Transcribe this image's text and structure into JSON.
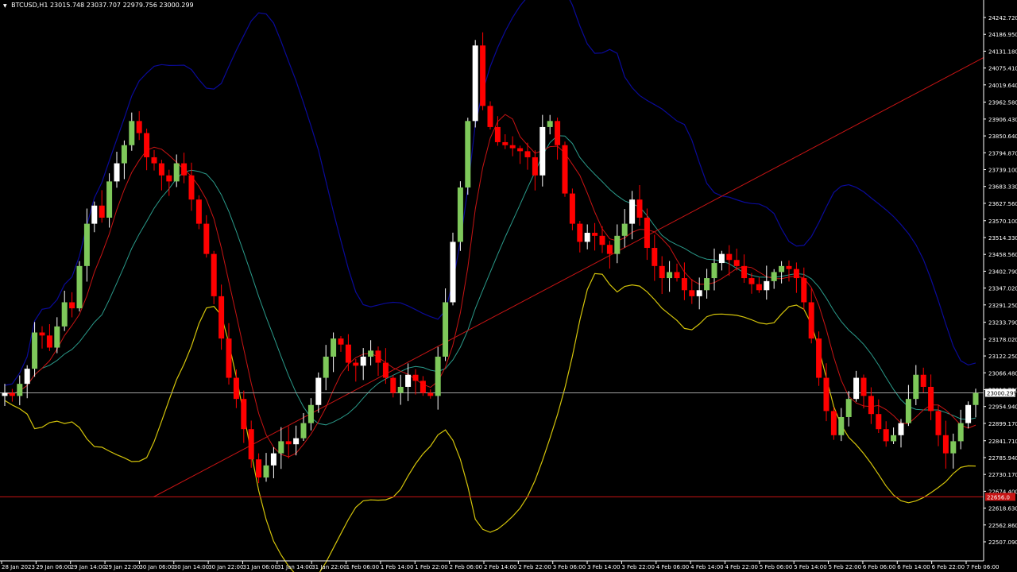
{
  "header": {
    "symbol": "BTCUSD,H1",
    "ohlc": "23015.748 23037.707 22979.756 23000.299"
  },
  "colors": {
    "background": "#000000",
    "axis": "#ffffff",
    "bull_candle": "#7ec85a",
    "bull_wick": "#ffffff",
    "bear_candle": "#ff0000",
    "bb_upper": "#0a0a9a",
    "bb_lower": "#d4c40a",
    "ma_fast": "#c81414",
    "ma_slow": "#2a9a8a",
    "trendline": "#c81414",
    "support": "#c81414",
    "current_price": "#a0a0a0"
  },
  "chart_data": {
    "type": "candlestick",
    "ylim": [
      22507.0,
      24290.0
    ],
    "y_ticks": [
      "24242.720",
      "24186.950",
      "24131.180",
      "24075.410",
      "24019.640",
      "23962.580",
      "23906.430",
      "23850.640",
      "23794.870",
      "23739.100",
      "23683.330",
      "23627.560",
      "23570.100",
      "23514.330",
      "23458.560",
      "23402.790",
      "23347.020",
      "23291.250",
      "23233.790",
      "23178.020",
      "23122.250",
      "23066.480",
      "23010.710",
      "22954.940",
      "22899.170",
      "22841.710",
      "22785.940",
      "22730.170",
      "22674.400",
      "22618.630",
      "22562.860",
      "22507.090"
    ],
    "x_ticks": [
      "28 Jan 2023",
      "29 Jan 06:00",
      "29 Jan 14:00",
      "29 Jan 22:00",
      "30 Jan 06:00",
      "30 Jan 14:00",
      "30 Jan 22:00",
      "31 Jan 06:00",
      "31 Jan 14:00",
      "31 Jan 22:00",
      "1 Feb 06:00",
      "1 Feb 14:00",
      "1 Feb 22:00",
      "2 Feb 06:00",
      "2 Feb 14:00",
      "2 Feb 22:00",
      "3 Feb 06:00",
      "3 Feb 14:00",
      "3 Feb 22:00",
      "4 Feb 06:00",
      "4 Feb 14:00",
      "4 Feb 22:00",
      "5 Feb 06:00",
      "5 Feb 14:00",
      "5 Feb 22:00",
      "6 Feb 06:00",
      "6 Feb 14:00",
      "6 Feb 22:00",
      "7 Feb 06:00"
    ],
    "current_price": 23000.299,
    "current_price_label": "23000.299",
    "support_price": 22656.0,
    "support_label": "22656.0",
    "trendline": {
      "from": [
        "30 Jan 06:00",
        22656
      ],
      "to": [
        "7 Feb 14:00",
        24110
      ]
    },
    "path": [
      23000,
      22990,
      23030,
      23080,
      23200,
      23190,
      23150,
      23220,
      23300,
      23280,
      23420,
      23560,
      23620,
      23580,
      23700,
      23760,
      23820,
      23900,
      23860,
      23780,
      23760,
      23720,
      23700,
      23760,
      23720,
      23640,
      23560,
      23460,
      23320,
      23180,
      23050,
      22980,
      22880,
      22780,
      22720,
      22760,
      22800,
      22840,
      22830,
      22850,
      22900,
      22960,
      23050,
      23120,
      23180,
      23160,
      23100,
      23090,
      23120,
      23140,
      23100,
      23050,
      23000,
      23020,
      23060,
      23040,
      23000,
      22990,
      23120,
      23300,
      23500,
      23680,
      23900,
      24150,
      23950,
      23880,
      23830,
      23820,
      23810,
      23800,
      23780,
      23720,
      23880,
      23900,
      23820,
      23660,
      23560,
      23500,
      23530,
      23520,
      23490,
      23460,
      23520,
      23560,
      23640,
      23580,
      23480,
      23420,
      23380,
      23400,
      23380,
      23340,
      23320,
      23340,
      23380,
      23430,
      23460,
      23440,
      23420,
      23380,
      23360,
      23340,
      23370,
      23400,
      23420,
      23410,
      23380,
      23300,
      23180,
      23050,
      22940,
      22860,
      22920,
      22980,
      23050,
      22990,
      22930,
      22880,
      22840,
      22860,
      22900,
      22980,
      23060,
      23020,
      22940,
      22860,
      22800,
      22840,
      22900,
      22960,
      23000
    ]
  }
}
